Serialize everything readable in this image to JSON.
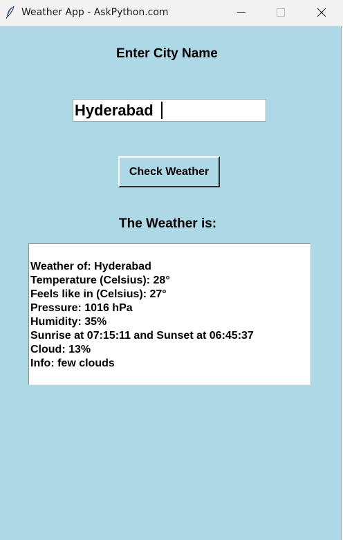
{
  "window": {
    "title": "Weather App - AskPython.com",
    "icon": "feather-icon",
    "controls": [
      "minimize-icon",
      "maximize-icon",
      "close-icon"
    ]
  },
  "form": {
    "city_heading": "Enter City Name",
    "city_value": "Hyderabad",
    "check_button_label": "Check Weather"
  },
  "result": {
    "heading": "The Weather is:",
    "lines": [
      "Weather of: Hyderabad",
      "Temperature (Celsius): 28°",
      "Feels like in (Celsius): 27°",
      "Pressure: 1016 hPa",
      "Humidity: 35%",
      "Sunrise at 07:15:11 and Sunset at 06:45:37",
      "Cloud: 13%",
      "Info: few clouds"
    ]
  },
  "colors": {
    "background": "#add8e6",
    "titlebar": "#f3f3f3"
  }
}
